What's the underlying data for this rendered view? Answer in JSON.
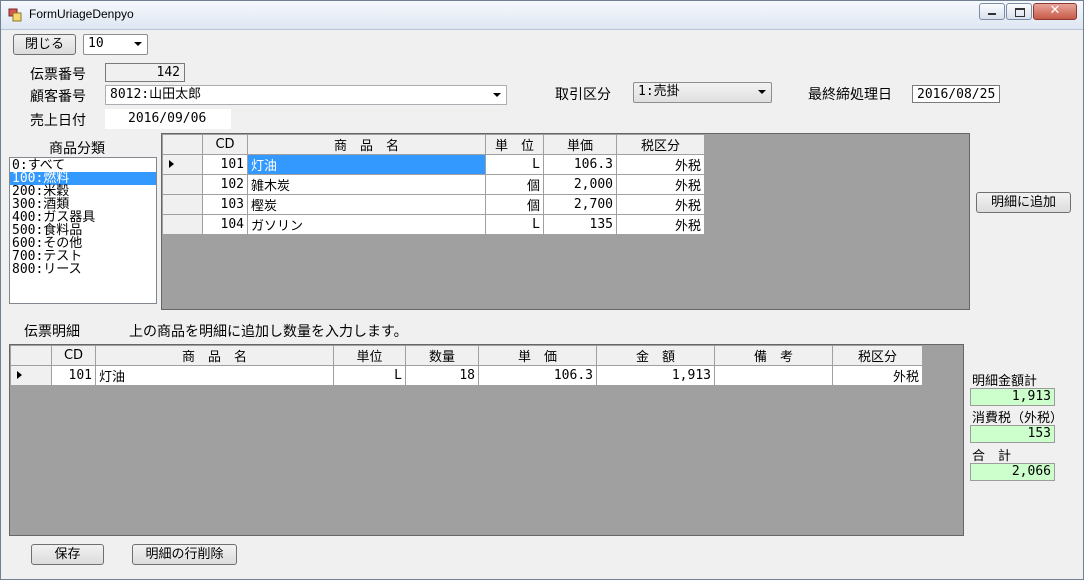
{
  "window": {
    "title": "FormUriageDenpyo"
  },
  "toolbar": {
    "close_label": "閉じる",
    "count_value": "10"
  },
  "header": {
    "denpyo_no_label": "伝票番号",
    "denpyo_no_value": "142",
    "customer_label": "顧客番号",
    "customer_value": "8012:山田太郎",
    "sales_date_label": "売上日付",
    "sales_date_value": "2016/09/06",
    "trade_type_label": "取引区分",
    "trade_type_value": "1:売掛",
    "closing_date_label": "最終締処理日",
    "closing_date_value": "2016/08/25"
  },
  "category": {
    "label": "商品分類",
    "selected_index": 1,
    "items": [
      "0:すべて",
      "100:燃料",
      "200:米穀",
      "300:酒類",
      "400:ガス器具",
      "500:食料品",
      "600:その他",
      "700:テスト",
      "800:リース"
    ]
  },
  "product_grid": {
    "columns": [
      "CD",
      "商　品　名",
      "単　位",
      "単価",
      "税区分"
    ],
    "rows": [
      [
        "101",
        "灯油",
        "L",
        "106.3",
        "外税"
      ],
      [
        "102",
        "雑木炭",
        "個",
        "2,000",
        "外税"
      ],
      [
        "103",
        "樫炭",
        "個",
        "2,700",
        "外税"
      ],
      [
        "104",
        "ガソリン",
        "L",
        "135",
        "外税"
      ]
    ]
  },
  "add_button_label": "明細に追加",
  "detail": {
    "label": "伝票明細",
    "hint": "上の商品を明細に追加し数量を入力します。",
    "columns": [
      "CD",
      "商　品　名",
      "単位",
      "数量",
      "単　価",
      "金　額",
      "備　考",
      "税区分"
    ],
    "rows": [
      [
        "101",
        "灯油",
        "L",
        "18",
        "106.3",
        "1,913",
        "",
        "外税"
      ]
    ]
  },
  "summary": {
    "subtotal_label": "明細金額計",
    "subtotal_value": "1,913",
    "tax_label": "消費税（外税）",
    "tax_value": "153",
    "total_label": "合　計",
    "total_value": "2,066"
  },
  "footer": {
    "save_label": "保存",
    "delete_row_label": "明細の行削除"
  },
  "colors": {
    "selection": "#3399ff",
    "sum_bg": "#ccffcc",
    "grid_bg": "#a0a0a0"
  }
}
